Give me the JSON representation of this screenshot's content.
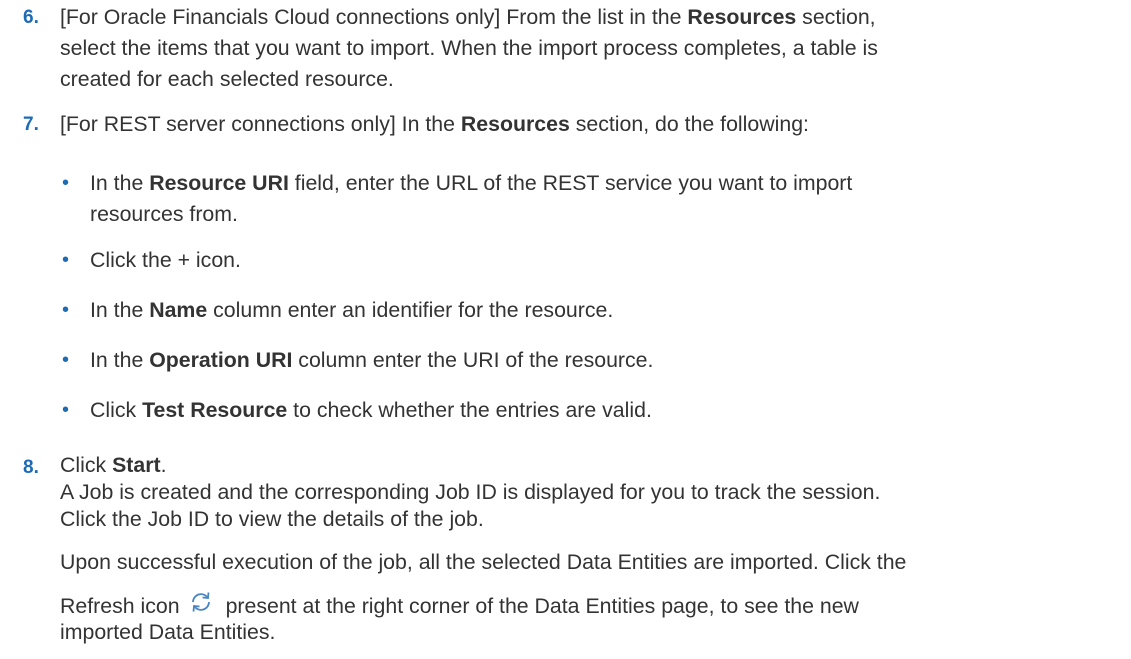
{
  "step6": {
    "number": "6.",
    "pre": "[For Oracle Financials Cloud connections only] From the list in the ",
    "bold1": "Resources",
    "mid": " section,",
    "line2": "select the items that you want to import. When the import process completes, a table is",
    "line3": "created for each selected resource."
  },
  "step7": {
    "number": "7.",
    "pre": "[For REST server connections only] In the ",
    "bold1": "Resources",
    "post": " section, do the following:",
    "bullets": [
      {
        "pre": "In the ",
        "bold": "Resource URI",
        "post": " field, enter the URL of the REST service you want to import",
        "line2": "resources from."
      },
      {
        "pre": "Click the + icon.",
        "bold": "",
        "post": ""
      },
      {
        "pre": "In the ",
        "bold": "Name",
        "post": " column enter an identifier for the resource."
      },
      {
        "pre": "In the ",
        "bold": "Operation URI",
        "post": " column enter the URI of the resource."
      },
      {
        "pre": "Click ",
        "bold": "Test Resource",
        "post": " to check whether the entries are valid."
      }
    ]
  },
  "step8": {
    "number": "8.",
    "pre": "Click ",
    "bold": "Start",
    "post": ".",
    "line2": "A Job is created and the corresponding Job ID is displayed for you to track the session.",
    "line3": "Click the Job ID to view the details of the job.",
    "para2_line1": "Upon successful execution of the job, all the selected Data Entities are imported. Click the",
    "para2_pre": "Refresh icon",
    "para2_post": "present at the right corner of the Data Entities page, to see the new",
    "para2_line3": "imported Data Entities."
  },
  "bullet_symbol": "•",
  "colors": {
    "accent": "#1d6bb5",
    "text": "#333333"
  },
  "icons": {
    "refresh": "refresh-icon"
  }
}
